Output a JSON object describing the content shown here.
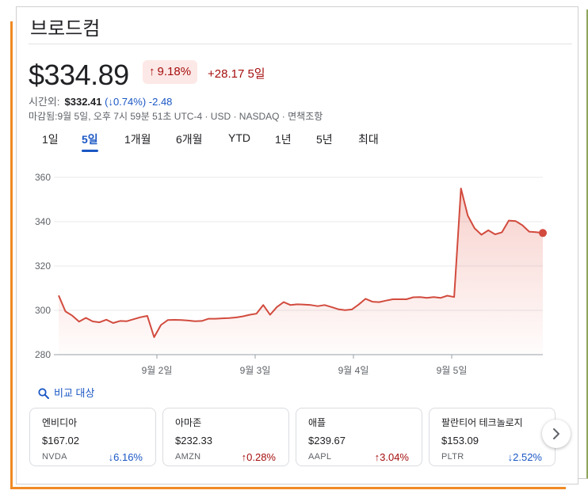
{
  "header": {
    "title": "브로드컴"
  },
  "quote": {
    "price": "$334.89",
    "change_pct": "9.18%",
    "change_pct_arrow": "↑",
    "change_abs": "+28.17 5일",
    "after_hours_label": "시간외:",
    "after_hours_price": "$332.41",
    "after_hours_pct": "(↓0.74%)",
    "after_hours_change": "-2.48",
    "meta": "마감됨:9월 5일, 오후 7시 59분 51초 UTC-4 · USD · NASDAQ · 면책조항"
  },
  "tabs": [
    {
      "label": "1일",
      "active": false
    },
    {
      "label": "5일",
      "active": true
    },
    {
      "label": "1개월",
      "active": false
    },
    {
      "label": "6개월",
      "active": false
    },
    {
      "label": "YTD",
      "active": false
    },
    {
      "label": "1년",
      "active": false
    },
    {
      "label": "5년",
      "active": false
    },
    {
      "label": "최대",
      "active": false
    }
  ],
  "chart_data": {
    "type": "area",
    "y_ticks": [
      "360",
      "340",
      "320",
      "300",
      "280"
    ],
    "ylim": [
      280,
      360
    ],
    "x_ticks": [
      "9월 2일",
      "9월 3일",
      "9월 4일",
      "9월 5일"
    ],
    "grid": true,
    "line_color": "#d24b3e",
    "values": [
      306.7,
      299.5,
      297.6,
      294.9,
      296.6,
      295.0,
      294.6,
      295.8,
      294.3,
      295.2,
      295.1,
      296.0,
      296.9,
      297.5,
      287.9,
      293.4,
      295.6,
      295.7,
      295.6,
      295.4,
      295.1,
      295.2,
      296.2,
      296.2,
      296.4,
      296.5,
      296.8,
      297.3,
      298.0,
      298.5,
      302.4,
      298.0,
      301.5,
      303.7,
      302.4,
      302.7,
      302.6,
      302.4,
      301.9,
      302.4,
      301.5,
      300.5,
      300.1,
      300.4,
      302.6,
      305.2,
      303.9,
      303.7,
      304.4,
      305.0,
      305.0,
      305.0,
      305.9,
      306.0,
      305.6,
      306.0,
      305.6,
      306.6,
      306.0,
      355.0,
      342.7,
      337.0,
      334.1,
      336.1,
      334.3,
      335.2,
      340.5,
      340.3,
      338.4,
      335.5,
      335.3,
      334.89
    ]
  },
  "compare": {
    "label": "비교 대상"
  },
  "related": [
    {
      "name": "엔비디아",
      "price": "$167.02",
      "ticker": "NVDA",
      "change": "6.16%",
      "arrow": "↓",
      "dir": "down"
    },
    {
      "name": "아마존",
      "price": "$232.33",
      "ticker": "AMZN",
      "change": "0.28%",
      "arrow": "↑",
      "dir": "up"
    },
    {
      "name": "애플",
      "price": "$239.67",
      "ticker": "AAPL",
      "change": "3.04%",
      "arrow": "↑",
      "dir": "up"
    },
    {
      "name": "팔란티어 테크놀로지",
      "price": "$153.09",
      "ticker": "PLTR",
      "change": "2.52%",
      "arrow": "↓",
      "dir": "down"
    }
  ],
  "colors": {
    "accent": "#1a57c4",
    "up": "#a50e0e",
    "badge_bg": "#fce8e6",
    "chart_line": "#d24b3e"
  },
  "icons": {
    "compare": "search-icon",
    "next": "chevron-right-icon"
  }
}
